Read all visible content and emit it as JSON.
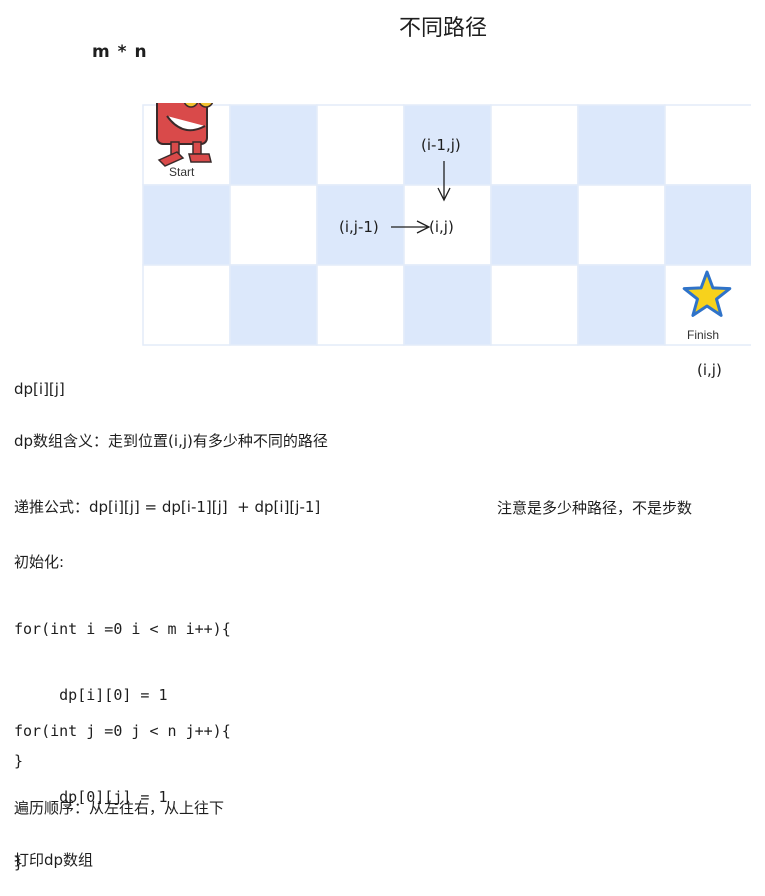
{
  "title": "不同路径",
  "dims_label": "m * n",
  "grid": {
    "rows": 3,
    "cols": 7,
    "colors": {
      "shaded": "#dce8fb",
      "plain": "#ffffff",
      "line": "#e3ecf9"
    },
    "start_label": "Start",
    "finish_label": "Finish",
    "robot": {
      "body": "#d94a4a",
      "outline": "#3a2a2a",
      "eyes": "#f2c230"
    },
    "star": {
      "fill": "#f7d21c",
      "stroke": "#2f73c9"
    }
  },
  "annotations": {
    "top_cell": "(i-1,j)",
    "left_cell": "(i,j-1)",
    "target_cell": "(i,j)",
    "finish_coord": "(i,j)"
  },
  "notes": {
    "dp_symbol": "dp[i][j]",
    "meaning": "dp数组含义：走到位置(i,j)有多少种不同的路径",
    "recurrence": "递推公式：dp[i][j] = dp[i-1][j]  + dp[i][j-1]",
    "caution": "注意是多少种路径，不是步数",
    "init_title": "初始化:",
    "loop1": [
      "for(int i =0 i < m i++){",
      "     dp[i][0] = 1",
      "}"
    ],
    "loop2": [
      "for(int j =0 j < n j++){",
      "     dp[0][j] = 1",
      "}"
    ],
    "order": "遍历顺序：从左往右，从上往下",
    "print": "打印dp数组"
  }
}
